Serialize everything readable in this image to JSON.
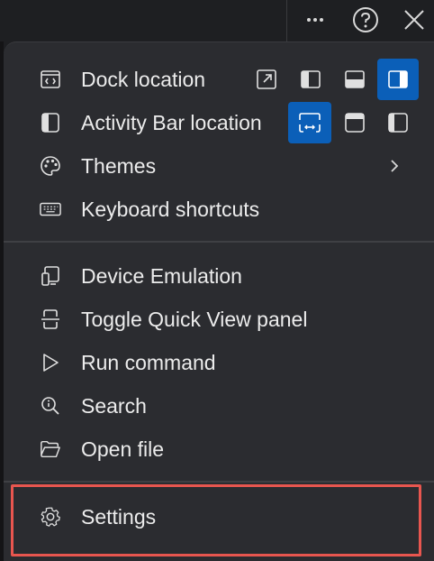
{
  "topbar": {
    "more_icon": "more-icon",
    "help_icon": "help-icon",
    "close_icon": "close-icon"
  },
  "menu": {
    "items": [
      {
        "label": "Dock location",
        "icon": "dock-icon"
      },
      {
        "label": "Activity Bar location",
        "icon": "activity-bar-icon"
      },
      {
        "label": "Themes",
        "icon": "palette-icon"
      },
      {
        "label": "Keyboard shortcuts",
        "icon": "keyboard-icon"
      },
      {
        "label": "Device Emulation",
        "icon": "device-icon"
      },
      {
        "label": "Toggle Quick View panel",
        "icon": "quick-view-icon"
      },
      {
        "label": "Run command",
        "icon": "play-icon"
      },
      {
        "label": "Search",
        "icon": "search-icon"
      },
      {
        "label": "Open file",
        "icon": "folder-icon"
      },
      {
        "label": "Settings",
        "icon": "gear-icon"
      }
    ],
    "dock_options": [
      "undock",
      "dock-left",
      "dock-bottom",
      "dock-right"
    ],
    "dock_selected": "dock-right",
    "activity_options": [
      "hidden",
      "top",
      "left"
    ],
    "activity_selected": "hidden"
  },
  "colors": {
    "selected": "#0b5fb8",
    "highlight_border": "#e8564f",
    "menu_bg": "#2b2c30"
  }
}
